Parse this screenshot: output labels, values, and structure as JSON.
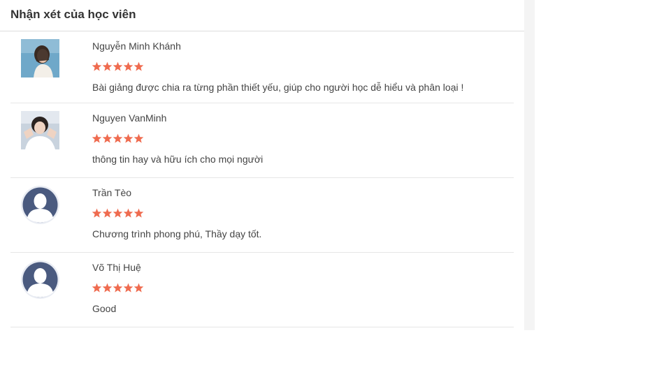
{
  "section": {
    "title": "Nhận xét của học viên"
  },
  "colors": {
    "star": "#ef6b4f",
    "avatar_placeholder_bg": "#e9ecf3",
    "avatar_placeholder_fg": "#4a5a7f"
  },
  "reviews": [
    {
      "name": "Nguyễn Minh Khánh",
      "rating": 5,
      "comment": "Bài giảng được chia ra từng phần thiết yếu, giúp cho người học dễ hiểu và phân loại !",
      "avatar": "photo"
    },
    {
      "name": "Nguyen VanMinh",
      "rating": 5,
      "comment": "thông tin hay và hữu ích cho mọi người",
      "avatar": "photo"
    },
    {
      "name": "Trần Tèo",
      "rating": 5,
      "comment": "Chương trình phong phú, Thầy dạy tốt.",
      "avatar": "default-user-icon"
    },
    {
      "name": "Võ Thị Huệ",
      "rating": 5,
      "comment": "Good",
      "avatar": "default-user-icon"
    }
  ]
}
